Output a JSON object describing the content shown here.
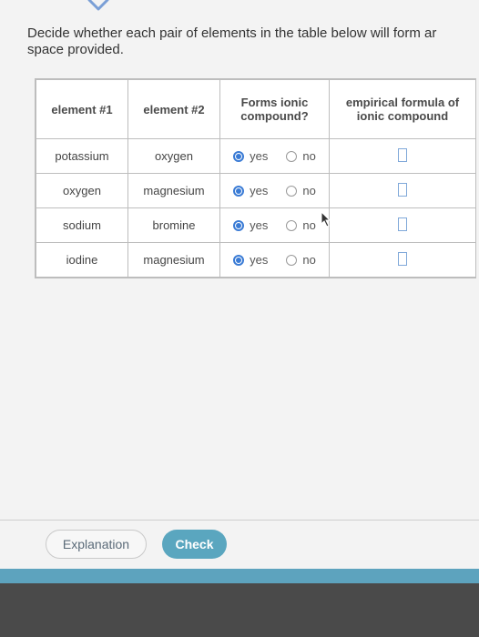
{
  "prompt": {
    "line1": "Decide whether each pair of elements in the table below will form ar",
    "line2": "space provided."
  },
  "table": {
    "headers": {
      "element1": "element #1",
      "element2": "element #2",
      "forms_ionic_line1": "Forms ionic",
      "forms_ionic_line2": "compound?",
      "formula_line1": "empirical formula of",
      "formula_line2": "ionic compound"
    },
    "rows": [
      {
        "element1": "potassium",
        "element2": "oxygen",
        "yes": "yes",
        "no": "no",
        "selected": "yes"
      },
      {
        "element1": "oxygen",
        "element2": "magnesium",
        "yes": "yes",
        "no": "no",
        "selected": "yes"
      },
      {
        "element1": "sodium",
        "element2": "bromine",
        "yes": "yes",
        "no": "no",
        "selected": "yes"
      },
      {
        "element1": "iodine",
        "element2": "magnesium",
        "yes": "yes",
        "no": "no",
        "selected": "yes"
      }
    ]
  },
  "buttons": {
    "explanation": "Explanation",
    "check": "Check"
  },
  "colors": {
    "accent": "#3a7bd5",
    "check_button": "#5aa6bf",
    "bottom_bar": "#5da3be"
  }
}
